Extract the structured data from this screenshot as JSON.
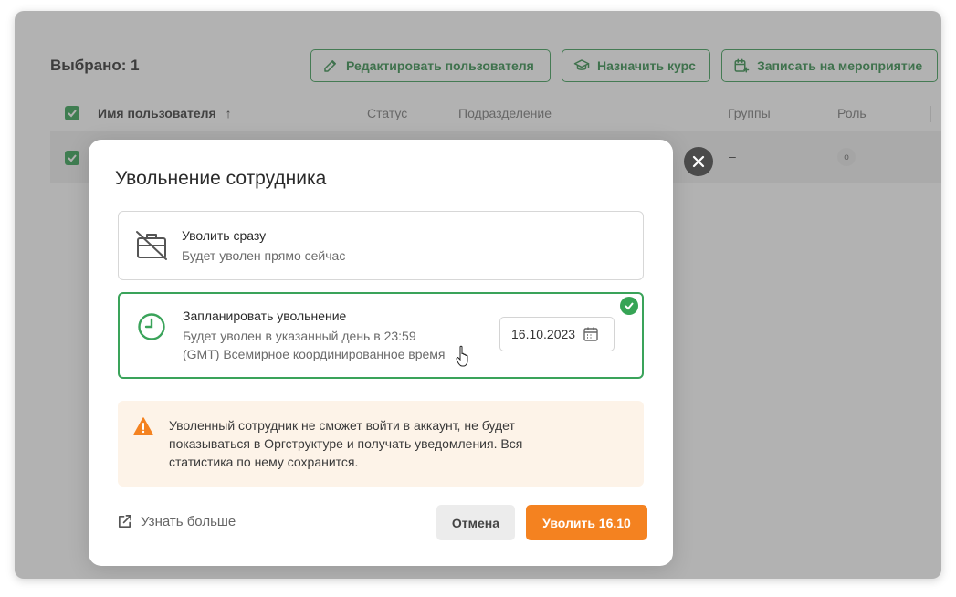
{
  "page": {
    "selected_count": "Выбрано: 1"
  },
  "toolbar": {
    "edit_user": "Редактировать пользователя",
    "assign_course": "Назначить курс",
    "enroll_event": "Записать на мероприятие"
  },
  "table": {
    "columns": [
      "Имя пользователя",
      "Статус",
      "Подразделение",
      "Группы",
      "Роль"
    ],
    "row": {
      "groups": "–",
      "role": "o"
    }
  },
  "modal": {
    "title": "Увольнение сотрудника",
    "options": [
      {
        "title": "Уволить сразу",
        "desc": "Будет уволен прямо сейчас",
        "icon": "briefcase-off-icon",
        "selected": false
      },
      {
        "title": "Запланировать увольнение",
        "desc_line1": "Будет уволен в указанный день в 23:59",
        "desc_line2": "(GMT) Всемирное координированное время",
        "icon": "clock-icon",
        "selected": true
      }
    ],
    "date_value": "16.10.2023",
    "warning": "Уволенный сотрудник не сможет войти в аккаунт, не будет показываться в Оргструктуре и получать уведомления. Вся статистика по нему сохранится.",
    "learn_more": "Узнать больше",
    "cancel": "Отмена",
    "confirm": "Уволить 16.10"
  },
  "colors": {
    "accent_green": "#3aa35a",
    "accent_orange": "#f48220",
    "warning_bg": "#fdf3e8"
  }
}
